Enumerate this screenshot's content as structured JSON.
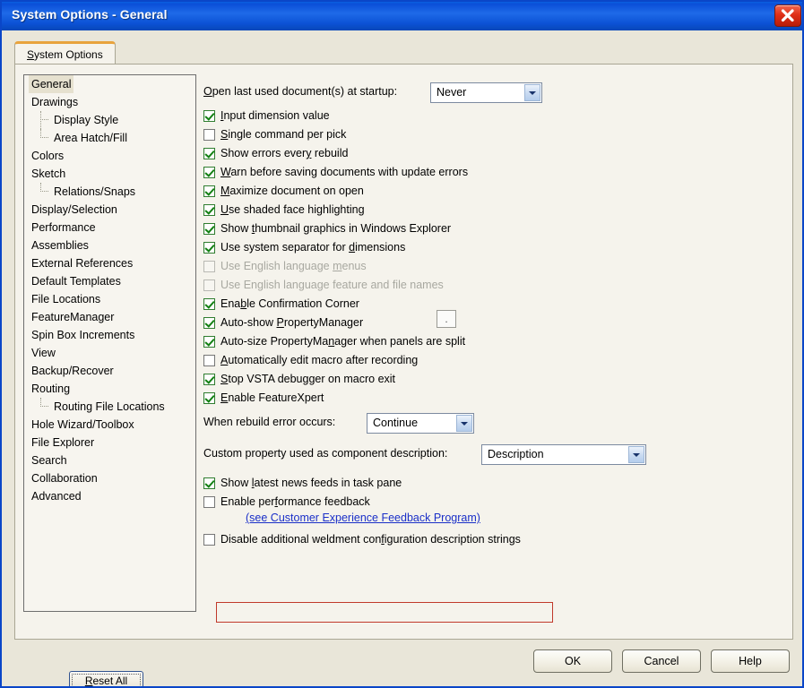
{
  "window": {
    "title": "System Options - General",
    "close_icon": "close-icon"
  },
  "tab": {
    "label_prefix": "",
    "accel": "S",
    "label_rest": "ystem Options"
  },
  "sidebar": {
    "items": [
      {
        "label": "General",
        "level": 0,
        "selected": true
      },
      {
        "label": "Drawings",
        "level": 0,
        "selected": false
      },
      {
        "label": "Display Style",
        "level": 1,
        "selected": false
      },
      {
        "label": "Area Hatch/Fill",
        "level": 1,
        "selected": false
      },
      {
        "label": "Colors",
        "level": 0,
        "selected": false
      },
      {
        "label": "Sketch",
        "level": 0,
        "selected": false
      },
      {
        "label": "Relations/Snaps",
        "level": 1,
        "selected": false
      },
      {
        "label": "Display/Selection",
        "level": 0,
        "selected": false
      },
      {
        "label": "Performance",
        "level": 0,
        "selected": false
      },
      {
        "label": "Assemblies",
        "level": 0,
        "selected": false
      },
      {
        "label": "External References",
        "level": 0,
        "selected": false
      },
      {
        "label": "Default Templates",
        "level": 0,
        "selected": false
      },
      {
        "label": "File Locations",
        "level": 0,
        "selected": false
      },
      {
        "label": "FeatureManager",
        "level": 0,
        "selected": false
      },
      {
        "label": "Spin Box Increments",
        "level": 0,
        "selected": false
      },
      {
        "label": "View",
        "level": 0,
        "selected": false
      },
      {
        "label": "Backup/Recover",
        "level": 0,
        "selected": false
      },
      {
        "label": "Routing",
        "level": 0,
        "selected": false
      },
      {
        "label": "Routing File Locations",
        "level": 1,
        "selected": false
      },
      {
        "label": "Hole Wizard/Toolbox",
        "level": 0,
        "selected": false
      },
      {
        "label": "File Explorer",
        "level": 0,
        "selected": false
      },
      {
        "label": "Search",
        "level": 0,
        "selected": false
      },
      {
        "label": "Collaboration",
        "level": 0,
        "selected": false
      },
      {
        "label": "Advanced",
        "level": 0,
        "selected": false
      }
    ],
    "reset_all": {
      "accel": "R",
      "rest": "eset All"
    }
  },
  "options": {
    "startup_label": {
      "accel": "O",
      "rest": "pen last used document(s) at startup:"
    },
    "startup_value": "Never",
    "checkboxes": [
      {
        "pre": "",
        "accel": "I",
        "post": "nput dimension value",
        "checked": true,
        "disabled": false
      },
      {
        "pre": "",
        "accel": "S",
        "post": "ingle command per pick",
        "checked": false,
        "disabled": false
      },
      {
        "pre": "Show errors ever",
        "accel": "y",
        "post": " rebuild",
        "checked": true,
        "disabled": false
      },
      {
        "pre": "",
        "accel": "W",
        "post": "arn before saving documents with update errors",
        "checked": true,
        "disabled": false
      },
      {
        "pre": "",
        "accel": "M",
        "post": "aximize document on open",
        "checked": true,
        "disabled": false
      },
      {
        "pre": "",
        "accel": "U",
        "post": "se shaded face highlighting",
        "checked": true,
        "disabled": false
      },
      {
        "pre": "Show ",
        "accel": "t",
        "post": "humbnail graphics in Windows Explorer",
        "checked": true,
        "disabled": false
      },
      {
        "pre": "Use system separator for ",
        "accel": "d",
        "post": "imensions",
        "checked": true,
        "disabled": false
      },
      {
        "pre": "Use English language ",
        "accel": "m",
        "post": "enus",
        "checked": false,
        "disabled": true
      },
      {
        "pre": "Use En",
        "accel": "g",
        "post": "lish language feature and file names",
        "checked": false,
        "disabled": true
      },
      {
        "pre": "Ena",
        "accel": "b",
        "post": "le Confirmation Corner",
        "checked": true,
        "disabled": false
      },
      {
        "pre": "Auto-show ",
        "accel": "P",
        "post": "ropertyManager",
        "checked": true,
        "disabled": false
      },
      {
        "pre": "Auto-size PropertyMa",
        "accel": "n",
        "post": "ager when panels are split",
        "checked": true,
        "disabled": false
      },
      {
        "pre": "",
        "accel": "A",
        "post": "utomatically edit macro after recording",
        "checked": false,
        "disabled": false
      },
      {
        "pre": "",
        "accel": "S",
        "post": "top VSTA debugger on macro exit",
        "checked": true,
        "disabled": false
      },
      {
        "pre": "",
        "accel": "E",
        "post": "nable FeatureXpert",
        "checked": true,
        "disabled": false
      }
    ],
    "separator_value": ".",
    "rebuild_label": "When rebuild error occurs:",
    "rebuild_value": "Continue",
    "custom_prop_label": "Custom property used as component description:",
    "custom_prop_value": "Description",
    "news_feed": {
      "pre": "Show ",
      "accel": "l",
      "post": "atest news feeds in task pane",
      "checked": true
    },
    "perf_feedback": {
      "pre": "Enable per",
      "accel": "f",
      "post": "ormance feedback",
      "checked": false
    },
    "feedback_link": "(see Customer Experience Feedback Program)",
    "weldment": {
      "pre": "Disable additional weldment con",
      "accel": "f",
      "post": "iguration description strings",
      "checked": false
    },
    "highlight_color": "#c0392b"
  },
  "footer": {
    "ok": "OK",
    "cancel": "Cancel",
    "help": "Help"
  }
}
